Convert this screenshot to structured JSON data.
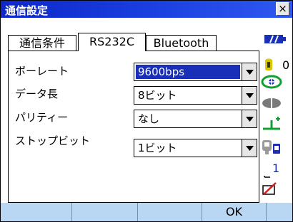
{
  "window": {
    "title": "通信設定",
    "close_label": "×"
  },
  "tabs": [
    {
      "label": "通信条件"
    },
    {
      "label": "RS232C"
    },
    {
      "label": "Bluetooth"
    }
  ],
  "active_tab": "RS232C",
  "settings": [
    {
      "label": "ボーレート",
      "value": "9600bps"
    },
    {
      "label": "データ長",
      "value": "8ビット"
    },
    {
      "label": "パリティー",
      "value": "なし"
    },
    {
      "label": "ストップビット",
      "value": "1ビット"
    }
  ],
  "status": {
    "memory_count": "0",
    "page_indicator": "1"
  },
  "softkeys": [
    "",
    "",
    "",
    "OK",
    ""
  ],
  "colors": {
    "title_bar": "#1a3ee0",
    "selection": "#1a2fb8",
    "softkey_bg": "#b9d7f2"
  }
}
